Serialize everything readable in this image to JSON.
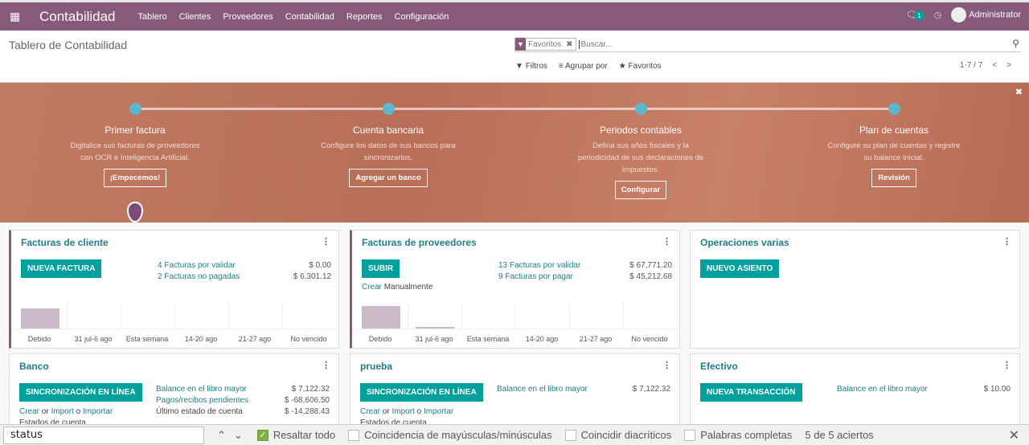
{
  "navbar": {
    "app_title": "Contabilidad",
    "menu": [
      "Tablero",
      "Clientes",
      "Proveedores",
      "Contabilidad",
      "Reportes",
      "Configuración"
    ],
    "messages_count": "1",
    "user": "Administrator"
  },
  "control_panel": {
    "breadcrumb": "Tablero de Contabilidad",
    "facet": "Favoritos",
    "search_placeholder": "Buscar...",
    "filters": "Filtros",
    "group_by": "Agrupar por",
    "favorites": "Favoritos",
    "pager": "1-7 / 7"
  },
  "banner": {
    "steps": [
      {
        "title": "Primer factura",
        "desc": "Digitalice sus facturas de proveedores con OCR e Inteligencia Artificial.",
        "button": "¡Empecemos!"
      },
      {
        "title": "Cuenta bancaria",
        "desc": "Configure los datos de sus bancos para sincronizarlos.",
        "button": "Agregar un banco"
      },
      {
        "title": "Periodos contables",
        "desc": "Defina sus años fiscales y la periodicidad de sus declaraciones de impuestos.",
        "button": "Configurar"
      },
      {
        "title": "Plan de cuentas",
        "desc": "Configure su plan de cuentas y registre su balance inicial.",
        "button": "Revisión"
      }
    ]
  },
  "cards": {
    "customer": {
      "title": "Facturas de cliente",
      "button": "Nueva factura",
      "rows": [
        {
          "label": "4 Facturas por validar",
          "value": "$ 0.00"
        },
        {
          "label": "2 Facturas no pagadas",
          "value": "$ 6,301.12"
        }
      ]
    },
    "vendor": {
      "title": "Facturas de proveedores",
      "button": "Subir",
      "create": "Crear",
      "manual": "Manualmente",
      "rows": [
        {
          "label": "13 Facturas por validar",
          "value": "$ 67,771.20"
        },
        {
          "label": "9 Facturas por pagar",
          "value": "$ 45,212.68"
        }
      ]
    },
    "misc": {
      "title": "Operaciones varias",
      "button": "Nuevo asiento"
    },
    "bank": {
      "title": "Banco",
      "button": "Sincronización en línea",
      "create": "Crear",
      "or": "or",
      "import": "Import",
      "o": "o",
      "importar": "Importar",
      "statements": "Estados de cuenta",
      "rows": [
        {
          "label": "Balance en el libro mayor",
          "value": "$ 7,122.32"
        },
        {
          "label": "Pagos/recibos pendientes",
          "value": "$ -68,606.50"
        },
        {
          "label": "Último estado de cuenta",
          "value": "$ -14,288.43"
        }
      ]
    },
    "prueba": {
      "title": "prueba",
      "button": "Sincronización en línea",
      "create": "Crear",
      "or": "or",
      "import": "Import",
      "o": "o",
      "importar": "Importar",
      "statements": "Estados de cuenta",
      "rows": [
        {
          "label": "Balance en el libro mayor",
          "value": "$ 7,122.32"
        }
      ]
    },
    "cash": {
      "title": "Efectivo",
      "button": "Nueva transacción",
      "rows": [
        {
          "label": "Balance en el libro mayor",
          "value": "$ 10.00"
        }
      ]
    }
  },
  "chart_data": [
    {
      "type": "bar",
      "title": "Facturas de cliente",
      "categories": [
        "Debido",
        "31 jul-6 ago",
        "Esta semana",
        "14-20 ago",
        "21-27 ago",
        "No vencido"
      ],
      "values": [
        0.9,
        0,
        0,
        0,
        0,
        0
      ]
    },
    {
      "type": "bar",
      "title": "Facturas de proveedores",
      "categories": [
        "Debido",
        "31 jul-6 ago",
        "Esta semana",
        "14-20 ago",
        "21-27 ago",
        "No vencido"
      ],
      "values": [
        1.0,
        0.05,
        0,
        0,
        0,
        0
      ]
    }
  ],
  "findbar": {
    "query": "status",
    "highlight_all": "Resaltar todo",
    "match_case": "Coincidencia de mayúsculas/minúsculas",
    "diacritics": "Coincidir diacríticos",
    "whole_words": "Palabras completas",
    "result": "5 de 5 aciertos"
  }
}
